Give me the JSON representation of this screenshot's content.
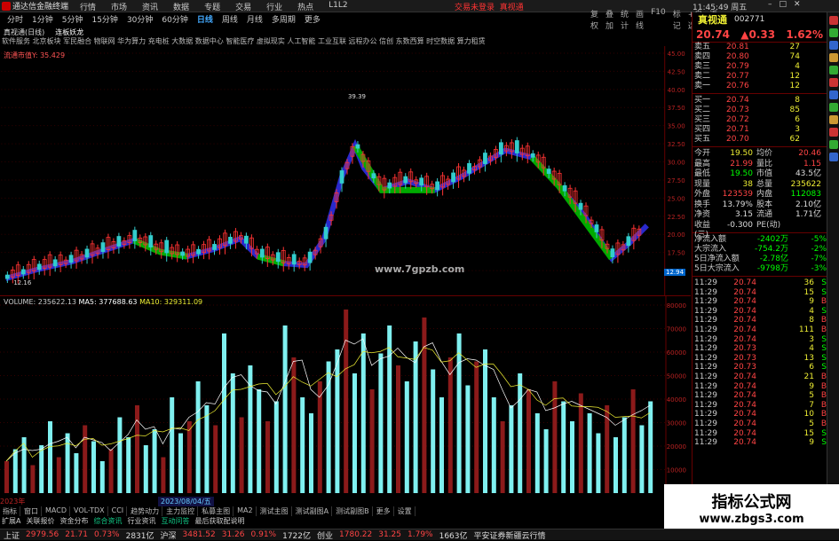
{
  "titlebar": {
    "app_title": "通达信金融终端",
    "menus": [
      "行情",
      "市场",
      "资讯",
      "数据",
      "专题",
      "交易",
      "行业",
      "热点",
      "L1L2"
    ],
    "login": "交易未登录",
    "stock_link": "真视通",
    "time": "11:45:49",
    "week": "周五"
  },
  "toolbar": {
    "periods": [
      "分时",
      "1分钟",
      "5分钟",
      "15分钟",
      "30分钟",
      "60分钟",
      "日线",
      "周线",
      "月线",
      "多周期",
      "更多"
    ],
    "active": "日线",
    "right": [
      "复权",
      "叠加",
      "统计",
      "画线",
      "F10",
      "标记",
      "+自选",
      "返回"
    ]
  },
  "stock": {
    "name_period": "真视通(日线)",
    "indicator": "连板妖龙"
  },
  "concepts": "软件服务 北京板块 军民融合 物联网 华为算力 充电桩 大数据 数据中心 智能医疗 虚拟现实 人工智能 工业互联 远程办公 信创 东数西算 时空数据 算力租赁",
  "kline": {
    "indicator_label": "流通市值Y:",
    "indicator_value": "35.429",
    "y_ticks": [
      "45.00",
      "42.50",
      "40.00",
      "37.50",
      "35.00",
      "32.50",
      "30.00",
      "27.50",
      "25.00",
      "22.50",
      "20.00",
      "17.50",
      "15.00"
    ],
    "peak_label": "39.39",
    "low_label": "12.16",
    "last_price": "12.94"
  },
  "volume": {
    "label": "VOLUME: 235622.13",
    "ma5": "MA5: 377688.63",
    "ma10": "MA10: 329311.09",
    "y_ticks": [
      "80000",
      "70000",
      "60000",
      "50000",
      "40000",
      "30000",
      "20000",
      "10000"
    ]
  },
  "dates": {
    "year": "2023年",
    "selected": "2023/08/04/五"
  },
  "tabs": [
    "指标",
    "窗口",
    "MACD",
    "VOL-TDX",
    "CCI",
    "趋势动力",
    "主力监控",
    "私募主图",
    "MA2",
    "测试主图",
    "测试副图A",
    "测试副图B",
    "更多",
    "设置"
  ],
  "tabs2": [
    {
      "text": "扩展A",
      "hl": false
    },
    {
      "text": "关联报价",
      "hl": false
    },
    {
      "text": "资金分布",
      "hl": false
    },
    {
      "text": "综合资讯",
      "hl": true
    },
    {
      "text": "行业资讯",
      "hl": false
    },
    {
      "text": "互动问答",
      "hl": true
    },
    {
      "text": "最后获取配说明",
      "hl": false
    }
  ],
  "watermark": "www.7gpzb.com",
  "rpanel": {
    "name": "真视通",
    "code": "002771",
    "price": "20.74",
    "change": "▲0.33",
    "pct": "1.62%",
    "asks": [
      {
        "l": "卖五",
        "p": "20.81",
        "v": "27"
      },
      {
        "l": "卖四",
        "p": "20.80",
        "v": "74"
      },
      {
        "l": "卖三",
        "p": "20.79",
        "v": "4"
      },
      {
        "l": "卖二",
        "p": "20.77",
        "v": "12"
      },
      {
        "l": "卖一",
        "p": "20.76",
        "v": "12"
      }
    ],
    "bids": [
      {
        "l": "买一",
        "p": "20.74",
        "v": "8"
      },
      {
        "l": "买二",
        "p": "20.73",
        "v": "85"
      },
      {
        "l": "买三",
        "p": "20.72",
        "v": "6"
      },
      {
        "l": "买四",
        "p": "20.71",
        "v": "3"
      },
      {
        "l": "买五",
        "p": "20.70",
        "v": "62"
      }
    ],
    "stats": [
      {
        "l": "今开",
        "v": "19.50",
        "vc": "yl",
        "l2": "均价",
        "v2": "20.46",
        "v2c": "up"
      },
      {
        "l": "最高",
        "v": "21.99",
        "vc": "up",
        "l2": "量比",
        "v2": "1.15",
        "v2c": "up"
      },
      {
        "l": "最低",
        "v": "19.50",
        "vc": "dn",
        "l2": "市值",
        "v2": "43.5亿",
        "v2c": "wh"
      },
      {
        "l": "现量",
        "v": "38",
        "vc": "yl",
        "l2": "总量",
        "v2": "235622",
        "v2c": "yl"
      },
      {
        "l": "外盘",
        "v": "123539",
        "vc": "up",
        "l2": "内盘",
        "v2": "112083",
        "v2c": "dn"
      },
      {
        "l": "换手",
        "v": "13.79%",
        "vc": "wh",
        "l2": "股本",
        "v2": "2.10亿",
        "v2c": "wh"
      },
      {
        "l": "净资",
        "v": "3.15",
        "vc": "wh",
        "l2": "流通",
        "v2": "1.71亿",
        "v2c": "wh"
      },
      {
        "l": "收益(三)",
        "v": "-0.300",
        "vc": "wh",
        "l2": "PE(动)",
        "v2": "",
        "v2c": "wh"
      }
    ],
    "flows": [
      {
        "l": "净流入额",
        "v": "-2402万",
        "p": "-5%",
        "c": "dn"
      },
      {
        "l": "大宗流入",
        "v": "-754.2万",
        "p": "-2%",
        "c": "dn"
      },
      {
        "l": "5日净流入额",
        "v": "-2.78亿",
        "p": "-7%",
        "c": "dn"
      },
      {
        "l": "5日大宗流入",
        "v": "-9798万",
        "p": "-3%",
        "c": "dn"
      }
    ],
    "ticks": [
      {
        "t": "11:29",
        "p": "20.74",
        "q": "36",
        "b": "S"
      },
      {
        "t": "11:29",
        "p": "20.74",
        "q": "15",
        "b": "S"
      },
      {
        "t": "11:29",
        "p": "20.74",
        "q": "9",
        "b": "B"
      },
      {
        "t": "11:29",
        "p": "20.74",
        "q": "4",
        "b": "S"
      },
      {
        "t": "11:29",
        "p": "20.74",
        "q": "8",
        "b": "B"
      },
      {
        "t": "11:29",
        "p": "20.74",
        "q": "111",
        "b": "B"
      },
      {
        "t": "11:29",
        "p": "20.74",
        "q": "3",
        "b": "S"
      },
      {
        "t": "11:29",
        "p": "20.73",
        "q": "4",
        "b": "S"
      },
      {
        "t": "11:29",
        "p": "20.73",
        "q": "13",
        "b": "S"
      },
      {
        "t": "11:29",
        "p": "20.73",
        "q": "6",
        "b": "S"
      },
      {
        "t": "11:29",
        "p": "20.74",
        "q": "21",
        "b": "B"
      },
      {
        "t": "11:29",
        "p": "20.74",
        "q": "9",
        "b": "B"
      },
      {
        "t": "11:29",
        "p": "20.74",
        "q": "5",
        "b": "B"
      },
      {
        "t": "11:29",
        "p": "20.74",
        "q": "7",
        "b": "B"
      },
      {
        "t": "11:29",
        "p": "20.74",
        "q": "10",
        "b": "B"
      },
      {
        "t": "11:29",
        "p": "20.74",
        "q": "5",
        "b": "B"
      },
      {
        "t": "11:29",
        "p": "20.74",
        "q": "15",
        "b": "S"
      },
      {
        "t": "11:29",
        "p": "20.74",
        "q": "9",
        "b": "S"
      }
    ]
  },
  "brand": {
    "line1": "指标公式网",
    "line2": "www.zbgs3.com"
  },
  "statusbar": [
    {
      "t": "上证",
      "c": "wh"
    },
    {
      "t": "2979.56",
      "c": "up"
    },
    {
      "t": "21.71",
      "c": "up"
    },
    {
      "t": "0.73%",
      "c": "up"
    },
    {
      "t": "2831亿",
      "c": "wh"
    },
    {
      "t": "沪深",
      "c": "wh"
    },
    {
      "t": "3481.52",
      "c": "up"
    },
    {
      "t": "31.26",
      "c": "up"
    },
    {
      "t": "0.91%",
      "c": "up"
    },
    {
      "t": "1722亿",
      "c": "wh"
    },
    {
      "t": "创业",
      "c": "wh"
    },
    {
      "t": "1780.22",
      "c": "up"
    },
    {
      "t": "31.25",
      "c": "up"
    },
    {
      "t": "1.79%",
      "c": "up"
    },
    {
      "t": "1663亿",
      "c": "wh"
    },
    {
      "t": "平安证券新疆云行情",
      "c": "wh"
    }
  ],
  "colors": {
    "up": "#ff4444",
    "down": "#00ff00",
    "volume_up": "#8b1a1a",
    "volume_down": "#7ff0f0",
    "accent": "#ffee33"
  }
}
